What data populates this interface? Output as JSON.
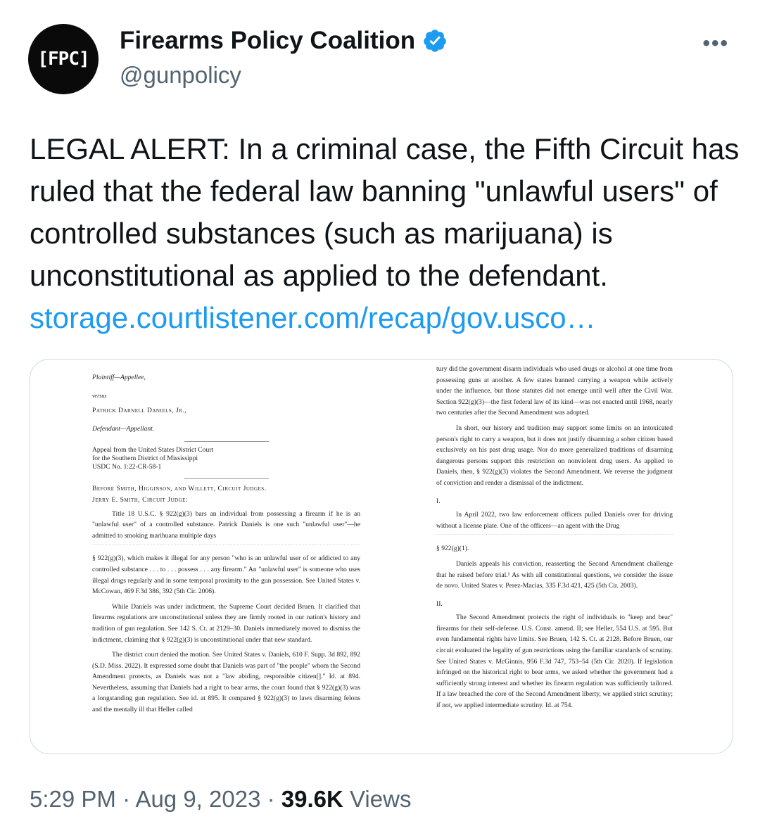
{
  "author": {
    "name": "Firearms Policy Coalition",
    "handle": "@gunpolicy",
    "avatar_text": "[FPC]",
    "verified_icon": "verified-badge-icon",
    "brand_color": "#1d9bf0"
  },
  "more_label": "•••",
  "tweet": {
    "text": "LEGAL ALERT: In a criminal case, the Fifth Circuit has ruled that the federal law banning \"unlawful users\" of controlled substances (such as marijuana) is unconstitutional as applied to the defendant.",
    "link": "storage.courtlistener.com/recap/gov.usco…"
  },
  "document": {
    "left": {
      "plaintiff": "Plaintiff—Appellee,",
      "versus": "versus",
      "defendant_name": "Patrick Darnell Daniels, Jr.,",
      "defendant_role": "Defendant—Appellant.",
      "appeal_1": "Appeal from the United States District Court",
      "appeal_2": "for the Southern District of Mississippi",
      "appeal_3": "USDC No. 1:22-CR-58-1",
      "judges": "Before Smith, Higginson, and Willett, Circuit Judges.",
      "author_judge": "Jerry E. Smith, Circuit Judge:",
      "para1": "Title 18 U.S.C. § 922(g)(3) bars an individual from possessing a firearm if he is an \"unlawful user\" of a controlled substance. Patrick Daniels is one such \"unlawful user\"—he admitted to smoking marihuana multiple days",
      "para2": "§ 922(g)(3), which makes it illegal for any person \"who is an unlawful user of or addicted to any controlled substance . . . to . . . possess . . . any firearm.\" An \"unlawful user\" is someone who uses illegal drugs regularly and in some temporal proximity to the gun possession. See United States v. McCowan, 469 F.3d 386, 392 (5th Cir. 2006).",
      "para3": "While Daniels was under indictment, the Supreme Court decided Bruen. It clarified that firearms regulations are unconstitutional unless they are firmly rooted in our nation's history and tradition of gun regulation. See 142 S. Ct. at 2129–30. Daniels immediately moved to dismiss the indictment, claiming that § 922(g)(3) is unconstitutional under that new standard.",
      "para4": "The district court denied the motion. See United States v. Daniels, 610 F. Supp. 3d 892, 892 (S.D. Miss. 2022). It expressed some doubt that Daniels was part of \"the people\" whom the Second Amendment protects, as Daniels was not a \"law abiding, responsible citizen[].\" Id. at 894. Nevertheless, assuming that Daniels had a right to bear arms, the court found that § 922(g)(3) was a longstanding gun regulation. See id. at 895. It compared § 922(g)(3) to laws disarming felons and the mentally ill that Heller called"
    },
    "right": {
      "para1": "tury did the government disarm individuals who used drugs or alcohol at one time from possessing guns at another. A few states banned carrying a weapon while actively under the influence, but those statutes did not emerge until well after the Civil War. Section 922(g)(3)—the first federal law of its kind—was not enacted until 1968, nearly two centuries after the Second Amendment was adopted.",
      "para2": "In short, our history and tradition may support some limits on an intoxicated person's right to carry a weapon, but it does not justify disarming a sober citizen based exclusively on his past drug usage. Nor do more generalized traditions of disarming dangerous persons support this restriction on nonviolent drug users. As applied to Daniels, then, § 922(g)(3) violates the Second Amendment. We reverse the judgment of conviction and render a dismissal of the indictment.",
      "heading1": "I.",
      "para3": "In April 2022, two law enforcement officers pulled Daniels over for driving without a license plate. One of the officers—an agent with the Drug",
      "para4": "§ 922(g)(1).",
      "para5": "Daniels appeals his conviction, reasserting the Second Amendment challenge that he raised before trial.¹ As with all constitutional questions, we consider the issue de novo. United States v. Perez-Macias, 335 F.3d 421, 425 (5th Cir. 2003).",
      "heading2": "II.",
      "para6": "The Second Amendment protects the right of individuals to \"keep and bear\" firearms for their self-defense. U.S. Const. amend. II; see Heller, 554 U.S. at 595. But even fundamental rights have limits. See Bruen, 142 S. Ct. at 2128. Before Bruen, our circuit evaluated the legality of gun restrictions using the familiar standards of scrutiny. See United States v. McGinnis, 956 F.3d 747, 753–54 (5th Cir. 2020). If legislation infringed on the historical right to bear arms, we asked whether the government had a sufficiently strong interest and whether its firearm regulation was sufficiently tailored. If a law breached the core of the Second Amendment liberty, we applied strict scrutiny; if not, we applied intermediate scrutiny. Id. at 754."
    }
  },
  "meta": {
    "time": "5:29 PM",
    "sep1": "·",
    "date": "Aug 9, 2023",
    "sep2": "·",
    "views_count": "39.6K",
    "views_label": "Views"
  }
}
